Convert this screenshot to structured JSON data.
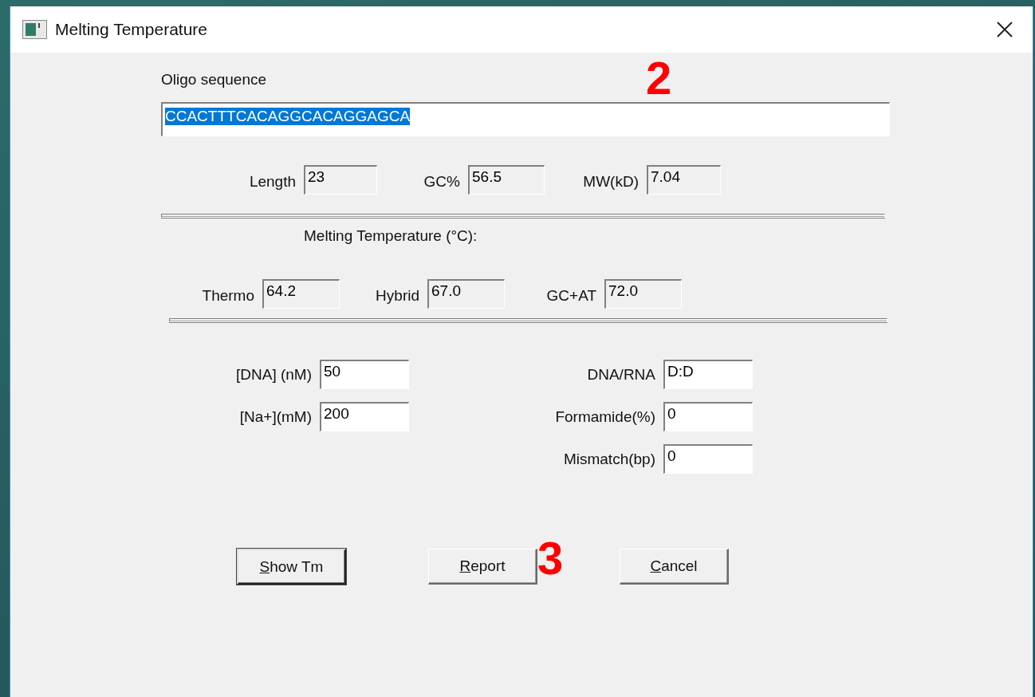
{
  "window": {
    "title": "Melting Temperature"
  },
  "sequence": {
    "label": "Oligo sequence",
    "value": "CCACTTTCACAGGCACAGGAGCA",
    "selected": true
  },
  "stats": [
    {
      "label": "Length",
      "value": "23"
    },
    {
      "label": "GC%",
      "value": "56.5"
    },
    {
      "label": "MW(kD)",
      "value": "7.04"
    }
  ],
  "melting": {
    "heading": "Melting Temperature (°C):",
    "results": [
      {
        "label": "Thermo",
        "value": "64.2"
      },
      {
        "label": "Hybrid",
        "value": "67.0"
      },
      {
        "label": "GC+AT",
        "value": "72.0"
      }
    ]
  },
  "params_left": [
    {
      "label": "[DNA] (nM)",
      "value": "50"
    },
    {
      "label": "[Na+](mM)",
      "value": "200"
    }
  ],
  "params_right": [
    {
      "label": "DNA/RNA",
      "value": "D:D"
    },
    {
      "label": "Formamide(%)",
      "value": "0"
    },
    {
      "label": "Mismatch(bp)",
      "value": "0"
    }
  ],
  "buttons": [
    {
      "key": "S",
      "rest": "how Tm",
      "default": true
    },
    {
      "key": "R",
      "rest": "eport",
      "default": false
    },
    {
      "key": "C",
      "rest": "ancel",
      "default": false
    }
  ],
  "annotations": [
    "2",
    "3"
  ]
}
